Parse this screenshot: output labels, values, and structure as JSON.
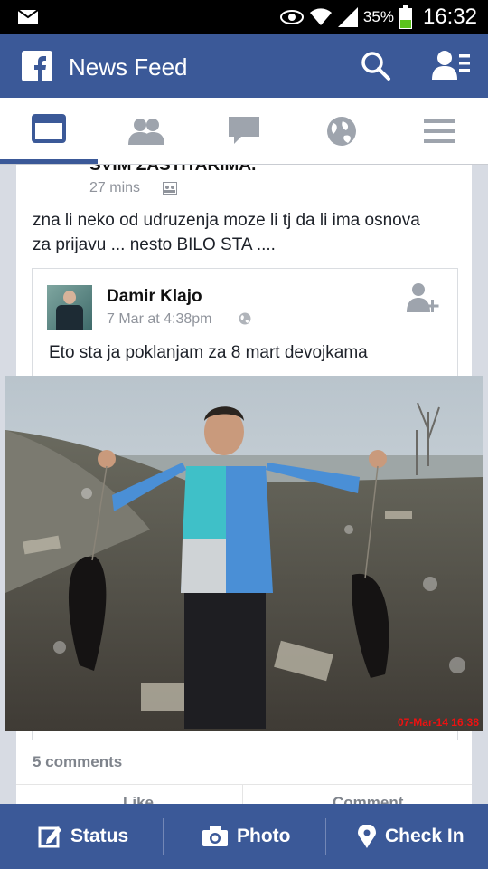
{
  "status_bar": {
    "battery_percent": "35%",
    "time": "16:32"
  },
  "app_bar": {
    "title": "News Feed"
  },
  "tabs": [
    {
      "name": "news-feed",
      "active": true
    },
    {
      "name": "friend-requests",
      "active": false
    },
    {
      "name": "messages",
      "active": false
    },
    {
      "name": "notifications",
      "active": false
    },
    {
      "name": "more",
      "active": false
    }
  ],
  "post": {
    "cut_title": "SVIM ZASTITARIMA.",
    "time": "27 mins",
    "text": "zna li neko od udruzenja moze li tj da li ima osnova za prijavu ... nesto BILO STA ....",
    "shared": {
      "author": "Damir Klajo",
      "time": "7 Mar at 4:38pm",
      "text": "Eto sta ja poklanjam za 8 mart devojkama",
      "photo_stamp": "07-Mar-14 16:38"
    },
    "comments": "5 comments",
    "like_label": "Like",
    "comment_label": "Comment"
  },
  "bottom_bar": {
    "status": "Status",
    "photo": "Photo",
    "check_in": "Check In"
  },
  "colors": {
    "brand": "#3b5998",
    "stamp": "#ee1111"
  }
}
